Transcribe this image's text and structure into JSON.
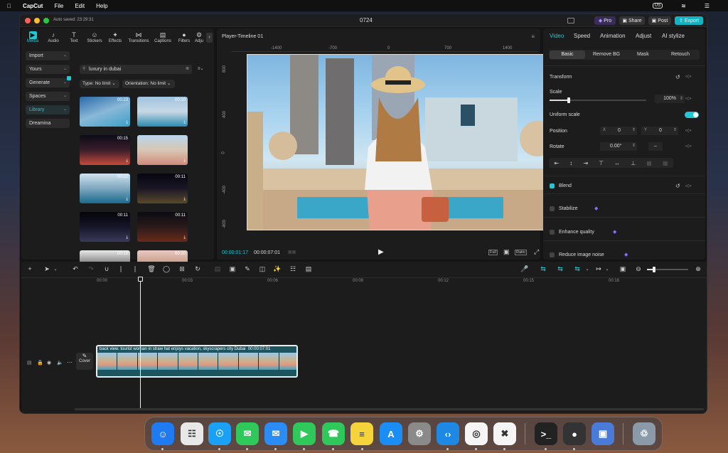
{
  "menubar": {
    "app": "CapCut",
    "items": [
      "File",
      "Edit",
      "Help"
    ],
    "input_badge": "US"
  },
  "window": {
    "autosave": "Auto saved: 23:29:31",
    "title": "0724",
    "pro_label": "Pro",
    "share_label": "Share",
    "post_label": "Post",
    "export_label": "Export"
  },
  "media_tabs": [
    {
      "label": "Media",
      "icon": "media-icon"
    },
    {
      "label": "Audio",
      "icon": "audio-icon"
    },
    {
      "label": "Text",
      "icon": "text-icon"
    },
    {
      "label": "Stickers",
      "icon": "stickers-icon"
    },
    {
      "label": "Effects",
      "icon": "effects-icon"
    },
    {
      "label": "Transitions",
      "icon": "transitions-icon"
    },
    {
      "label": "Captions",
      "icon": "captions-icon"
    },
    {
      "label": "Filters",
      "icon": "filters-icon"
    },
    {
      "label": "Adju",
      "icon": "adjust-icon"
    }
  ],
  "sidebar": [
    "Import",
    "Yours",
    "Generate",
    "Spaces",
    "Library",
    "Dreamina"
  ],
  "search": {
    "value": "luxury in dubai"
  },
  "filters": {
    "type": "Type: No limit",
    "orientation": "Orientation: No limit"
  },
  "thumbs": [
    {
      "dur": "00:23"
    },
    {
      "dur": "00:10"
    },
    {
      "dur": "00:15"
    },
    {
      "dur": ""
    },
    {
      "dur": "00:12"
    },
    {
      "dur": "00:11"
    },
    {
      "dur": "00:11"
    },
    {
      "dur": "00:11"
    },
    {
      "dur": "00:13"
    },
    {
      "dur": "00:20"
    }
  ],
  "player": {
    "title": "Player-Timeline 01",
    "ruler": [
      "-1400",
      "-700",
      "0",
      "700",
      "1400"
    ],
    "vruler": [
      "800",
      "400",
      "0",
      "-400",
      "-800"
    ],
    "current": "00:00:01:17",
    "total": "00:00:07:01",
    "full": "Full",
    "ratio": "Ratio"
  },
  "inspector": {
    "tabs": [
      "Video",
      "Speed",
      "Animation",
      "Adjust",
      "AI stylize"
    ],
    "subtabs": [
      "Basic",
      "Remove BG",
      "Mask",
      "Retouch"
    ],
    "transform": "Transform",
    "scale_label": "Scale",
    "scale_value": "100%",
    "scale_fraction": 0.2,
    "uniform": "Uniform scale",
    "position": "Position",
    "pos_x_label": "X",
    "pos_x": "0",
    "pos_y_label": "Y",
    "pos_y": "0",
    "rotate": "Rotate",
    "rotate_value": "0.00°",
    "rotate_dash": "–",
    "blend": "Blend",
    "stabilize": "Stabilize",
    "enhance": "Enhance quality",
    "reduce_noise": "Reduce image noise"
  },
  "timeline": {
    "ticks": [
      "00:00",
      "00:03",
      "00:06",
      "00:09",
      "00:12",
      "00:15",
      "00:18"
    ],
    "clip_label": "back view. tourist woman in straw hat enjoys vacation, skyscrapers city Dubai",
    "clip_duration": "00:00:07:01",
    "cover": "Cover"
  },
  "colors": {
    "accent": "#22c7d3",
    "clip": "#1c5560",
    "clip_border": "#e9eef0"
  },
  "dock": [
    "Finder",
    "Launchpad",
    "Safari",
    "Messages",
    "Mail",
    "FaceTime",
    "Phone",
    "Notes",
    "App Store",
    "System Settings",
    "VS Code",
    "Chrome",
    "CapCut",
    "Terminal",
    "OBS",
    "Disk Utility",
    "Trash"
  ]
}
